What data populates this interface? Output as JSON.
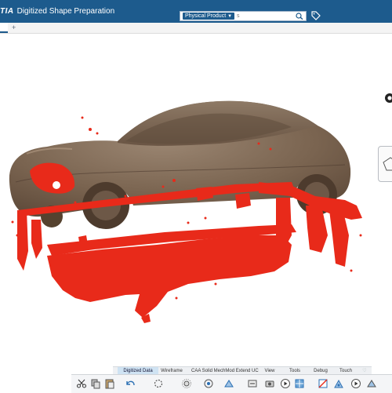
{
  "app": {
    "brand": "TIA",
    "title": "Digitized Shape Preparation"
  },
  "search": {
    "filter_label": "Physical Product",
    "placeholder": "s"
  },
  "ribbon": {
    "tabs": [
      "Digitized Data",
      "Wireframe",
      "CAA Solid MechMod Extend UC",
      "View",
      "Tools",
      "Debug",
      "Touch"
    ],
    "active_tab": "Digitized Data"
  },
  "colors": {
    "titlebar": "#1d5b8d",
    "point_cloud": "#e82a1a",
    "car_mesh": "#7c6551",
    "active_tab": "#cfe3f3"
  },
  "icons": [
    "search-icon",
    "tag-icon",
    "compass-icon",
    "view-cube-icon",
    "cut-icon",
    "copy-icon",
    "paste-icon",
    "undo-icon",
    "rotate-icon",
    "sun-icon",
    "network-icon",
    "snap-icon",
    "step-icon",
    "camera-icon",
    "play-icon",
    "grid-icon",
    "material-icon",
    "zoom-icon",
    "play-icon-2"
  ]
}
